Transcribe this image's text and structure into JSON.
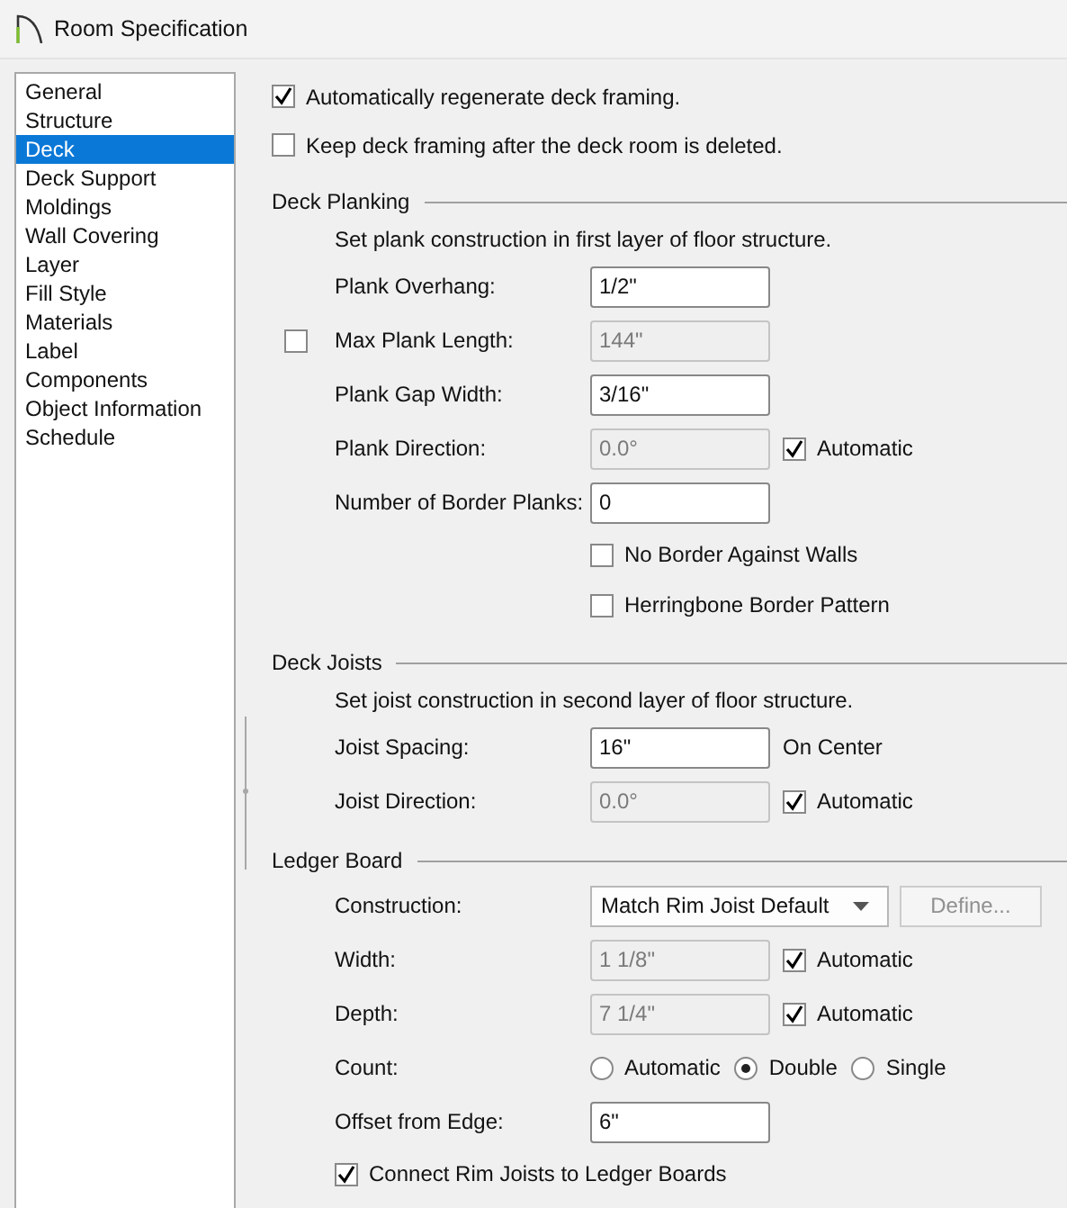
{
  "window": {
    "title": "Room Specification"
  },
  "sidebar": {
    "items": [
      {
        "label": "General",
        "selected": false
      },
      {
        "label": "Structure",
        "selected": false
      },
      {
        "label": "Deck",
        "selected": true
      },
      {
        "label": "Deck Support",
        "selected": false
      },
      {
        "label": "Moldings",
        "selected": false
      },
      {
        "label": "Wall Covering",
        "selected": false
      },
      {
        "label": "Layer",
        "selected": false
      },
      {
        "label": "Fill Style",
        "selected": false
      },
      {
        "label": "Materials",
        "selected": false
      },
      {
        "label": "Label",
        "selected": false
      },
      {
        "label": "Components",
        "selected": false
      },
      {
        "label": "Object Information",
        "selected": false
      },
      {
        "label": "Schedule",
        "selected": false
      }
    ]
  },
  "options": [
    {
      "label": "Automatically regenerate deck framing.",
      "checked": true
    },
    {
      "label": "Keep deck framing after the deck room is deleted.",
      "checked": false
    }
  ],
  "sections": [
    {
      "title": "Deck Planking",
      "description": "Set plank construction in first layer of floor structure.",
      "rows": [
        {
          "kind": "field",
          "label": "Plank Overhang:",
          "value": "1/2\"",
          "disabled": false
        },
        {
          "kind": "field",
          "label": "Max Plank Length:",
          "label_checked": false,
          "value": "144\"",
          "disabled": true
        },
        {
          "kind": "field",
          "label": "Plank Gap Width:",
          "value": "3/16\"",
          "disabled": false
        },
        {
          "kind": "field",
          "label": "Plank Direction:",
          "value": "0.0°",
          "disabled": true,
          "automatic": {
            "label": "Automatic",
            "checked": true
          }
        },
        {
          "kind": "field",
          "label": "Number of Border Planks:",
          "value": "0",
          "disabled": false
        },
        {
          "kind": "check",
          "label": "No Border Against Walls",
          "checked": false
        },
        {
          "kind": "check",
          "label": "Herringbone Border Pattern",
          "checked": false
        }
      ]
    },
    {
      "title": "Deck Joists",
      "description": "Set joist construction in second layer of floor structure.",
      "rows": [
        {
          "kind": "field",
          "label": "Joist Spacing:",
          "value": "16\"",
          "disabled": false,
          "note": "On Center"
        },
        {
          "kind": "field",
          "label": "Joist Direction:",
          "value": "0.0°",
          "disabled": true,
          "automatic": {
            "label": "Automatic",
            "checked": true
          }
        }
      ]
    },
    {
      "title": "Ledger Board",
      "rows": [
        {
          "kind": "select",
          "label": "Construction:",
          "value": "Match Rim Joist Default",
          "button": {
            "label": "Define...",
            "disabled": true
          }
        },
        {
          "kind": "field",
          "label": "Width:",
          "value": "1 1/8\"",
          "disabled": true,
          "automatic": {
            "label": "Automatic",
            "checked": true
          }
        },
        {
          "kind": "field",
          "label": "Depth:",
          "value": "7 1/4\"",
          "disabled": true,
          "automatic": {
            "label": "Automatic",
            "checked": true
          }
        },
        {
          "kind": "radios",
          "label": "Count:",
          "options": [
            {
              "label": "Automatic",
              "selected": false
            },
            {
              "label": "Double",
              "selected": true
            },
            {
              "label": "Single",
              "selected": false
            }
          ]
        },
        {
          "kind": "field",
          "label": "Offset from Edge:",
          "value": "6\"",
          "disabled": false
        },
        {
          "kind": "option",
          "label": "Connect Rim Joists to Ledger Boards",
          "checked": true
        }
      ]
    }
  ]
}
